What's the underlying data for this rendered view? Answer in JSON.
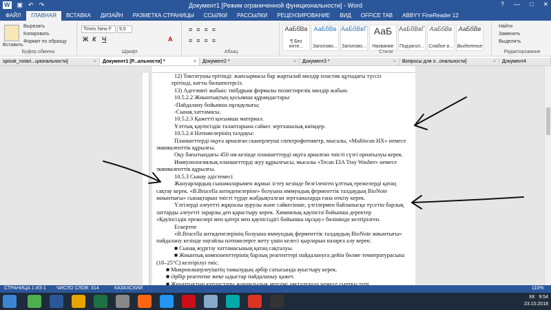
{
  "window": {
    "title": "Документ1 [Режим ограниченной функциональности] - Word",
    "controls": [
      "?",
      "—",
      "□",
      "✕"
    ]
  },
  "ribbon_tabs": [
    "ФАЙЛ",
    "ГЛАВНАЯ",
    "ВСТАВКА",
    "ДИЗАЙН",
    "РАЗМЕТКА СТРАНИЦЫ",
    "ССЫЛКИ",
    "РАССЫЛКИ",
    "РЕЦЕНЗИРОВАНИЕ",
    "ВИД",
    "OFFICE TAB",
    "ABBYY FineReader 12"
  ],
  "clipboard": {
    "paste": "Вставить",
    "cut": "Вырезать",
    "copy": "Копировать",
    "format": "Формат по образцу",
    "label": "Буфер обмена"
  },
  "font": {
    "name": "Times New F",
    "size": "9,5",
    "label": "Шрифт",
    "bold": "Ж",
    "italic": "К",
    "underline": "Ч"
  },
  "paragraph": {
    "label": "Абзац"
  },
  "styles": {
    "label": "Стили",
    "items": [
      {
        "preview": "АаБбВв",
        "name": "¶ Без инте..."
      },
      {
        "preview": "АаБбВв",
        "name": "Заголово..."
      },
      {
        "preview": "АаБбВвГ",
        "name": "Заголово..."
      },
      {
        "preview": "АаБ",
        "name": "Название"
      },
      {
        "preview": "АаБбВвГ",
        "name": "Подзагол..."
      },
      {
        "preview": "АаБбВв",
        "name": "Слабое в..."
      },
      {
        "preview": "АаБбВв",
        "name": "Выделение"
      }
    ]
  },
  "editing": {
    "find": "Найти",
    "replace": "Заменить",
    "select": "Выделить",
    "label": "Редактирование"
  },
  "doc_tabs": [
    {
      "label": "spisok_notari...циональности]",
      "active": false
    },
    {
      "label": "Документ1 [Р...альности] *",
      "active": true
    },
    {
      "label": "Документ2 *",
      "active": false
    },
    {
      "label": "Документ3 *",
      "active": false
    },
    {
      "label": "Вопросы для э...ональности]",
      "active": false
    },
    {
      "label": "Документ4",
      "active": false
    }
  ],
  "document": {
    "lines": [
      {
        "t": "12)    Токтатушы ерітінді: жапсырмасы бар жартылай мөлдір пластик құтыдағы түссіз",
        "c": "ind"
      },
      {
        "t": "ерітінді, катты бөлшектерсіз.",
        "c": "ind2"
      },
      {
        "t": "13)    Адгезивті жабын: тиібдрыш формалы полистирелік мөлдір жабын.",
        "c": "ind"
      },
      {
        "t": "10.5.2.2    Жиынтықтың қосымша құрамдастары:",
        "c": "ind"
      },
      {
        "t": "-Пайдалану бойынша нұсқаулығы;",
        "c": "ind"
      },
      {
        "t": "-Сынақ хаттамасы.",
        "c": "ind"
      },
      {
        "t": "10.5.2.3    Қажетті қосымша материал.",
        "c": "ind"
      },
      {
        "t": "Ұлттық қауіпсіздік талаптарына сәйкес зертханалық киімдер.",
        "c": "ind"
      },
      {
        "t": "10.5.2.4    Нәтижелерінің талдауы:",
        "c": "ind"
      },
      {
        "t": "Планшеттерді оқуға арналған сканерлеуші спектрофотометр, мысалы, «Multiscan HX» немесе",
        "c": "ind"
      },
      {
        "t": "эквиваленттік құрылғы.",
        "c": ""
      },
      {
        "t": "Оқу бағытындағы 450 нм кезінде планшеттерді оқуға арналған тиісті сүзгі орнатылуы керек.",
        "c": "ind"
      },
      {
        "t": "Иммунологиялық планшеттерді жуу құрылғысы, мысалы «Tecan EIA Tray Washer» немесе",
        "c": "ind"
      },
      {
        "t": "эквиваленттік құрылғы.",
        "c": ""
      },
      {
        "t": "10.5.3 Сынау әдістемесі",
        "c": "ind"
      },
      {
        "t": "Жануарлардың сынамаларымен жұмыс істеу кезінде белгіленген ұлттық ережелерді қатаң",
        "c": "ind"
      },
      {
        "t": "сақтау керек. «B.Brucella антиденелеріне» болуына иммундық ферменттік талдаудың BioNote",
        "c": ""
      },
      {
        "t": "жиынтығы» сынақтарын тиісті түрде жабдықталған зертханаларда ғана өткізу керек.",
        "c": ""
      },
      {
        "t": "Үлгілерді әлеуетті жұқпалы аурулы және сәйкесінше, үлгілермен байланысқа түсетін барлық",
        "c": "ind"
      },
      {
        "t": "заттарды әлеуетті зарарлы деп қарастыру керек. Химиялық қауіпсізі бойынша деректер",
        "c": ""
      },
      {
        "t": "«Қауіпсіздік ережелері мен қатері мен қауіпсіздігі бойынша нұсқау» бөлімінде келтірілген.",
        "c": ""
      },
      {
        "t": "Ескертпе",
        "c": "ind"
      },
      {
        "t": "«B.Brucella антиденелерінің болуына иммундық ферменттік талдаудың BioNote жиынтығы»",
        "c": "ind"
      },
      {
        "t": "пайдалану кезінде оңтайлы нәтижелерге жету үшін келесі қырларын назарға алу керек:",
        "c": ""
      },
      {
        "t": "■  Сынақ жүргізу хаттамасының қатаң сақталуы.",
        "c": "ind"
      },
      {
        "t": "■  Жиынтық компоненттерінің барлық реагенттері пайдалануға дейін бөлме температурасына",
        "c": "ind"
      },
      {
        "t": "(18–25°С) келтірілуі тиіс.",
        "c": ""
      },
      {
        "t": "■  Микроөлшерлеуіштің тамызудың әрбір сатысында ауыстыру керек.",
        "c": "bul"
      },
      {
        "t": "■  Әрбір реагентке жеке ыдыстар пайдаланыу қажет.",
        "c": "bul"
      },
      {
        "t": "■  Жиынтықтың құрдастары жарамдылық мерзімі аяқталғанда немесе сыртқы түрі",
        "c": "bul"
      }
    ]
  },
  "status": {
    "page": "СТРАНИЦА 1 ИЗ 1",
    "words": "ЧИСЛО СЛОВ: 314",
    "lang": "КАЗАХСКИЙ",
    "zoom": "110%"
  },
  "tray": {
    "lang": "КК",
    "time": "9:54",
    "date": "23.10.2018"
  }
}
